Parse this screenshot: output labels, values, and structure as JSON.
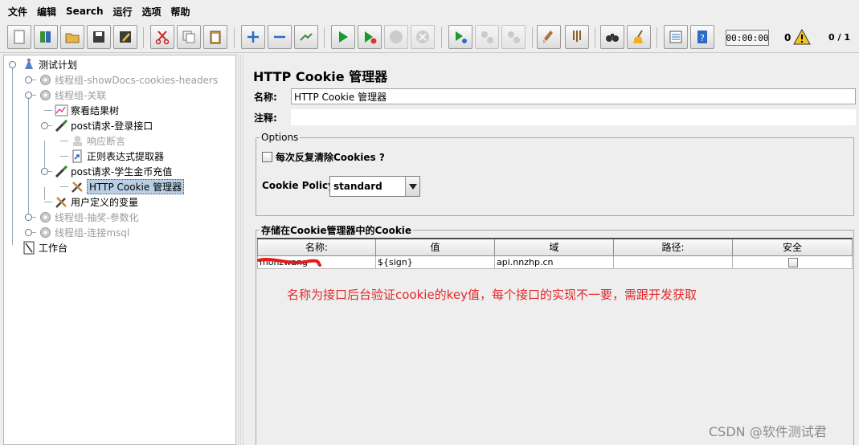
{
  "menu": [
    "文件",
    "编辑",
    "Search",
    "运行",
    "选项",
    "帮助"
  ],
  "toolbar": {
    "icons": [
      "new-icon",
      "templates-icon",
      "open-icon",
      "save-icon",
      "save-as-icon",
      "cut-icon",
      "copy-icon",
      "paste-icon",
      "expand-icon",
      "collapse-icon",
      "toggle-icon",
      "start-icon",
      "start-no-pause-icon",
      "stop-icon",
      "shutdown-icon",
      "remote-start-icon",
      "remote-stop-icon",
      "remote-shutdown-icon",
      "clear-icon",
      "clear-all-icon",
      "search-icon",
      "reset-search-icon",
      "function-helper-icon",
      "help-icon"
    ],
    "timer": "00:00:00",
    "error_count": "0",
    "threads": "0 / 1"
  },
  "tree": {
    "nodes": [
      {
        "label": "测试计划",
        "icon": "test-plan-icon",
        "disabled": false,
        "selected": false
      },
      {
        "label": "线程组-showDocs-cookies-headers",
        "icon": "thread-group-icon",
        "disabled": true,
        "selected": false
      },
      {
        "label": "线程组-关联",
        "icon": "thread-group-icon",
        "disabled": true,
        "selected": false
      },
      {
        "label": "察看结果树",
        "icon": "results-tree-icon",
        "disabled": false,
        "selected": false
      },
      {
        "label": "post请求-登录接口",
        "icon": "sampler-icon",
        "disabled": false,
        "selected": false
      },
      {
        "label": "响应断言",
        "icon": "assertion-icon",
        "disabled": true,
        "selected": false
      },
      {
        "label": "正则表达式提取器",
        "icon": "extractor-icon",
        "disabled": false,
        "selected": false
      },
      {
        "label": "post请求-学生金币充值",
        "icon": "sampler-icon",
        "disabled": false,
        "selected": false
      },
      {
        "label": "HTTP Cookie 管理器",
        "icon": "config-tool-icon",
        "disabled": false,
        "selected": true
      },
      {
        "label": "用户定义的变量",
        "icon": "config-tool-icon",
        "disabled": false,
        "selected": false
      },
      {
        "label": "线程组-抽奖-参数化",
        "icon": "thread-group-icon",
        "disabled": true,
        "selected": false
      },
      {
        "label": "线程组-连接msql",
        "icon": "thread-group-icon",
        "disabled": true,
        "selected": false
      },
      {
        "label": "工作台",
        "icon": "workbench-icon",
        "disabled": false,
        "selected": false
      }
    ]
  },
  "panel": {
    "title": "HTTP Cookie 管理器",
    "name_label": "名称:",
    "name_value": "HTTP Cookie 管理器",
    "comment_label": "注释:",
    "comment_value": "",
    "options_legend": "Options",
    "clear_each_iteration": "每次反复清除Cookies ?",
    "clear_each_iteration_checked": false,
    "policy_label": "Cookie Policy:",
    "policy_value": "standard",
    "stored_legend": "存储在Cookie管理器中的Cookie",
    "table": {
      "columns": [
        "名称:",
        "值",
        "域",
        "路径:",
        "安全"
      ],
      "rows": [
        {
          "name": "monzwang",
          "value": "${sign}",
          "domain": "api.nnzhp.cn",
          "path": "",
          "secure": false
        }
      ]
    },
    "annotation": "名称为接口后台验证cookie的key值，每个接口的实现不一要，需跟开发获取"
  },
  "watermark": "CSDN @软件测试君",
  "colors": {
    "annotation": "#e0282a",
    "selection": "#b8cfe5",
    "disabled_text": "#9b9b9b"
  }
}
